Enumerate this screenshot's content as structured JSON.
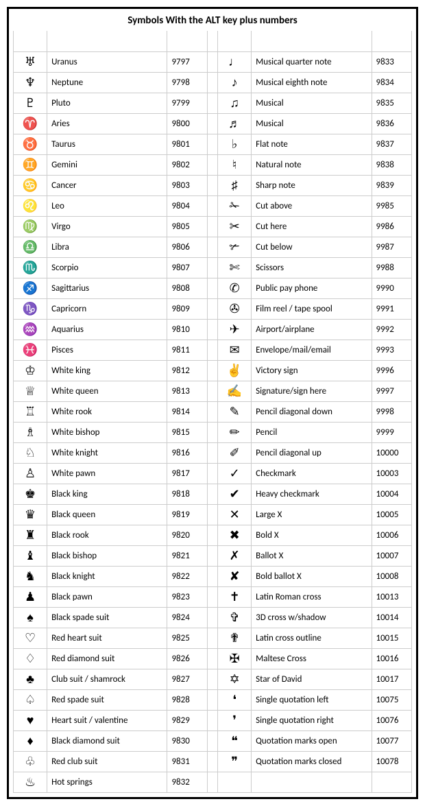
{
  "title": "Symbols With the ALT key plus numbers",
  "rows": [
    {
      "l": {
        "sym": "♅",
        "name": "Uranus",
        "code": "9797"
      },
      "r": {
        "sym": "♩",
        "name": "Musical quarter note",
        "code": "9833"
      }
    },
    {
      "l": {
        "sym": "♆",
        "name": "Neptune",
        "code": "9798"
      },
      "r": {
        "sym": "♪",
        "name": "Musical eighth note",
        "code": "9834"
      }
    },
    {
      "l": {
        "sym": "♇",
        "name": "Pluto",
        "code": "9799"
      },
      "r": {
        "sym": "♫",
        "name": "Musical",
        "code": "9835"
      }
    },
    {
      "l": {
        "sym": "♈",
        "name": "Aries",
        "code": "9800"
      },
      "r": {
        "sym": "♬",
        "name": "Musical",
        "code": "9836"
      }
    },
    {
      "l": {
        "sym": "♉",
        "name": "Taurus",
        "code": "9801"
      },
      "r": {
        "sym": "♭",
        "name": "Flat note",
        "code": "9837"
      }
    },
    {
      "l": {
        "sym": "♊",
        "name": "Gemini",
        "code": "9802"
      },
      "r": {
        "sym": "♮",
        "name": "Natural note",
        "code": "9838"
      }
    },
    {
      "l": {
        "sym": "♋",
        "name": "Cancer",
        "code": "9803"
      },
      "r": {
        "sym": "♯",
        "name": "Sharp note",
        "code": "9839"
      }
    },
    {
      "l": {
        "sym": "♌",
        "name": "Leo",
        "code": "9804"
      },
      "r": {
        "sym": "✁",
        "name": "Cut above",
        "code": "9985"
      }
    },
    {
      "l": {
        "sym": "♍",
        "name": "Virgo",
        "code": "9805"
      },
      "r": {
        "sym": "✂",
        "name": "Cut here",
        "code": "9986"
      }
    },
    {
      "l": {
        "sym": "♎",
        "name": "Libra",
        "code": "9806"
      },
      "r": {
        "sym": "✃",
        "name": "Cut below",
        "code": "9987"
      }
    },
    {
      "l": {
        "sym": "♏",
        "name": "Scorpio",
        "code": "9807"
      },
      "r": {
        "sym": "✄",
        "name": "Scissors",
        "code": "9988"
      }
    },
    {
      "l": {
        "sym": "♐",
        "name": "Sagittarius",
        "code": "9808"
      },
      "r": {
        "sym": "✆",
        "name": "Public pay phone",
        "code": "9990"
      }
    },
    {
      "l": {
        "sym": "♑",
        "name": "Capricorn",
        "code": "9809"
      },
      "r": {
        "sym": "✇",
        "name": "Film reel / tape spool",
        "code": "9991"
      }
    },
    {
      "l": {
        "sym": "♒",
        "name": "Aquarius",
        "code": "9810"
      },
      "r": {
        "sym": "✈",
        "name": "Airport/airplane",
        "code": "9992"
      }
    },
    {
      "l": {
        "sym": "♓",
        "name": "Pisces",
        "code": "9811"
      },
      "r": {
        "sym": "✉",
        "name": "Envelope/mail/email",
        "code": "9993"
      }
    },
    {
      "l": {
        "sym": "♔",
        "name": "White king",
        "code": "9812"
      },
      "r": {
        "sym": "✌",
        "name": "Victory sign",
        "code": "9996"
      }
    },
    {
      "l": {
        "sym": "♕",
        "name": "White queen",
        "code": "9813"
      },
      "r": {
        "sym": "✍",
        "name": "Signature/sign here",
        "code": "9997"
      }
    },
    {
      "l": {
        "sym": "♖",
        "name": "White rook",
        "code": "9814"
      },
      "r": {
        "sym": "✎",
        "name": "Pencil diagonal down",
        "code": "9998"
      }
    },
    {
      "l": {
        "sym": "♗",
        "name": "White bishop",
        "code": "9815"
      },
      "r": {
        "sym": "✏",
        "name": "Pencil",
        "code": "9999"
      }
    },
    {
      "l": {
        "sym": "♘",
        "name": "White knight",
        "code": "9816"
      },
      "r": {
        "sym": "✐",
        "name": "Pencil diagonal up",
        "code": "10000"
      }
    },
    {
      "l": {
        "sym": "♙",
        "name": "White pawn",
        "code": "9817"
      },
      "r": {
        "sym": "✓",
        "name": "Checkmark",
        "code": "10003"
      }
    },
    {
      "l": {
        "sym": "♚",
        "name": "Black king",
        "code": "9818"
      },
      "r": {
        "sym": "✔",
        "name": "Heavy checkmark",
        "code": "10004"
      }
    },
    {
      "l": {
        "sym": "♛",
        "name": "Black queen",
        "code": "9819"
      },
      "r": {
        "sym": "✕",
        "name": "Large X",
        "code": "10005"
      }
    },
    {
      "l": {
        "sym": "♜",
        "name": "Black rook",
        "code": "9820"
      },
      "r": {
        "sym": "✖",
        "name": "Bold X",
        "code": "10006"
      }
    },
    {
      "l": {
        "sym": "♝",
        "name": "Black bishop",
        "code": "9821"
      },
      "r": {
        "sym": "✗",
        "name": "Ballot X",
        "code": "10007"
      }
    },
    {
      "l": {
        "sym": "♞",
        "name": "Black knight",
        "code": "9822"
      },
      "r": {
        "sym": "✘",
        "name": "Bold ballot X",
        "code": "10008"
      }
    },
    {
      "l": {
        "sym": "♟",
        "name": "Black pawn",
        "code": "9823"
      },
      "r": {
        "sym": "✝",
        "name": "Latin Roman cross",
        "code": "10013"
      }
    },
    {
      "l": {
        "sym": "♠",
        "name": "Black spade suit",
        "code": "9824"
      },
      "r": {
        "sym": "✞",
        "name": "3D cross w/shadow",
        "code": "10014"
      }
    },
    {
      "l": {
        "sym": "♡",
        "name": "Red heart suit",
        "code": "9825"
      },
      "r": {
        "sym": "✟",
        "name": "Latin cross outline",
        "code": "10015"
      }
    },
    {
      "l": {
        "sym": "♢",
        "name": "Red diamond suit",
        "code": "9826"
      },
      "r": {
        "sym": "✠",
        "name": "Maltese Cross",
        "code": "10016"
      }
    },
    {
      "l": {
        "sym": "♣",
        "name": "Club suit / shamrock",
        "code": "9827"
      },
      "r": {
        "sym": "✡",
        "name": "Star of David",
        "code": "10017"
      }
    },
    {
      "l": {
        "sym": "♤",
        "name": "Red spade suit",
        "code": "9828"
      },
      "r": {
        "sym": "❛",
        "name": "Single quotation left",
        "code": "10075"
      }
    },
    {
      "l": {
        "sym": "♥",
        "name": "Heart suit / valentine",
        "code": "9829"
      },
      "r": {
        "sym": "❜",
        "name": "Single quotation right",
        "code": "10076"
      }
    },
    {
      "l": {
        "sym": "♦",
        "name": "Black diamond suit",
        "code": "9830"
      },
      "r": {
        "sym": "❝",
        "name": "Quotation marks open",
        "code": "10077"
      }
    },
    {
      "l": {
        "sym": "♧",
        "name": "Red club suit",
        "code": "9831"
      },
      "r": {
        "sym": "❞",
        "name": "Quotation marks closed",
        "code": "10078"
      }
    },
    {
      "l": {
        "sym": "♨",
        "name": "Hot springs",
        "code": "9832"
      },
      "r": {
        "sym": "",
        "name": "",
        "code": ""
      }
    }
  ]
}
